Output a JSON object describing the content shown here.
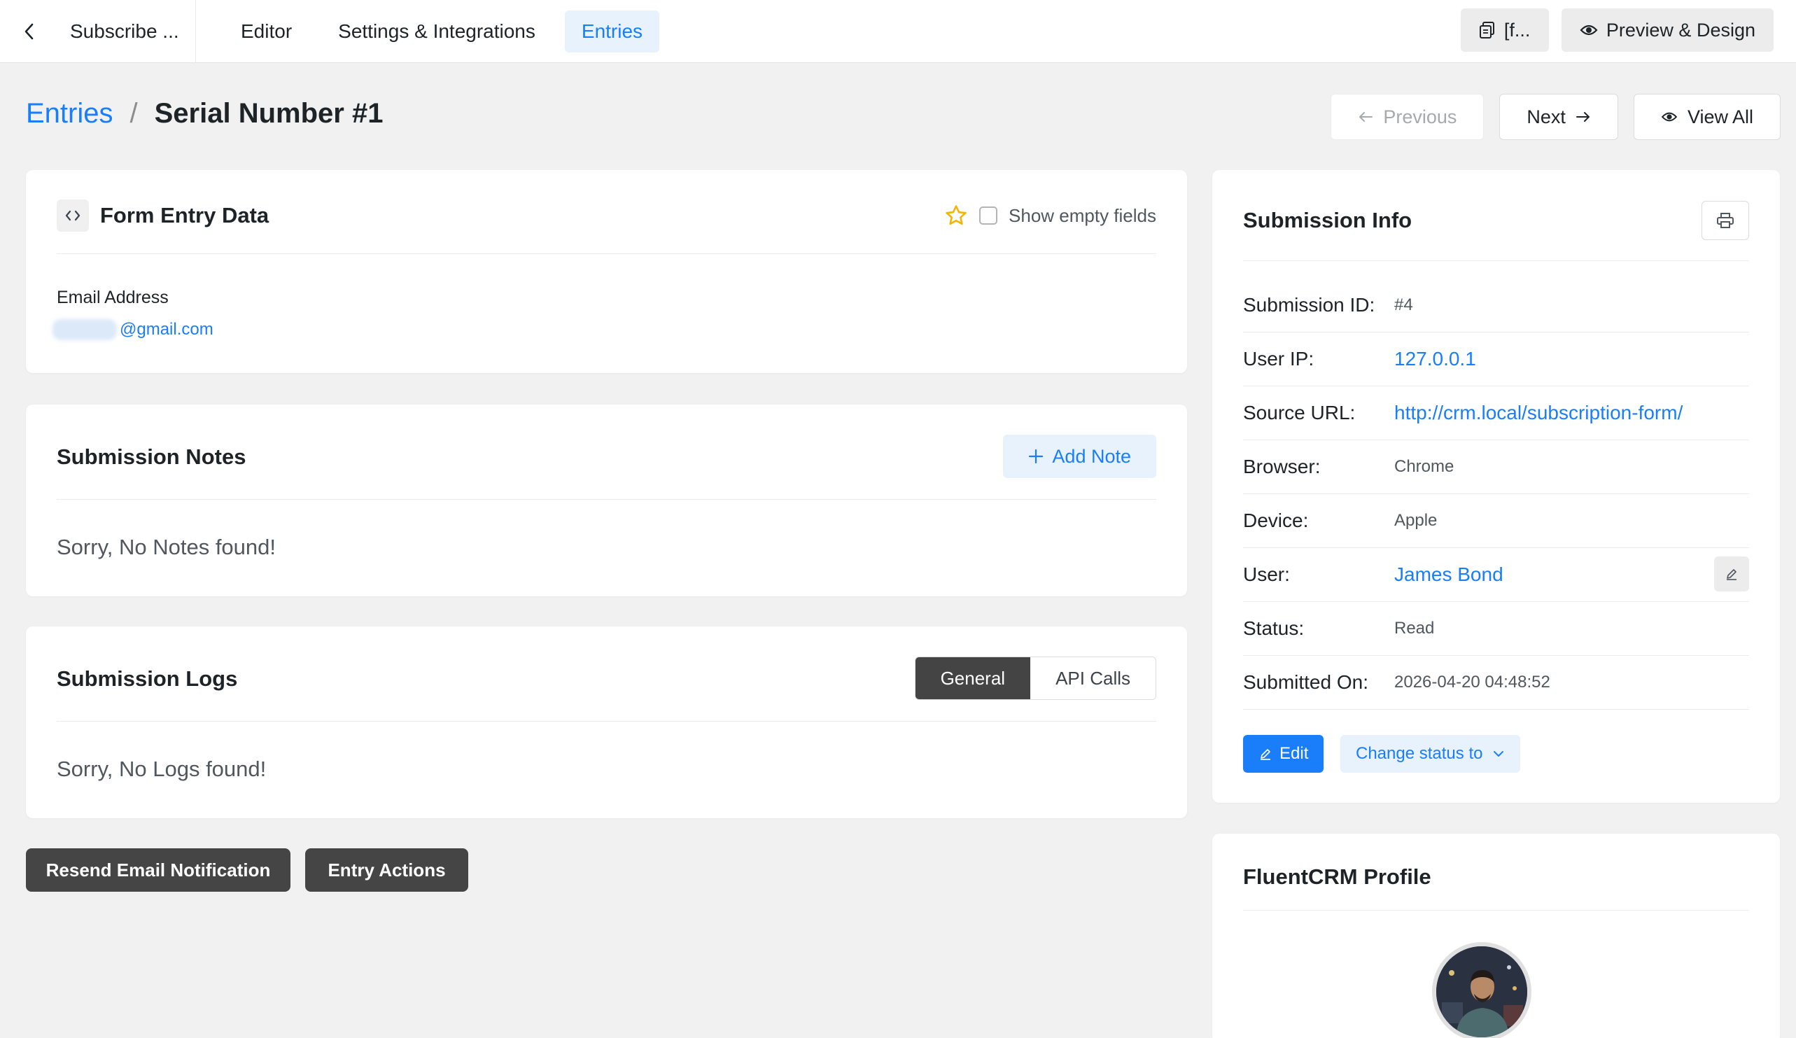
{
  "topnav": {
    "form_title": "Subscribe ...",
    "tabs": [
      "Editor",
      "Settings & Integrations",
      "Entries"
    ],
    "shortcode_label": "[f...",
    "preview_label": "Preview & Design"
  },
  "breadcrumb": {
    "parent": "Entries",
    "separator": "/",
    "current": "Serial Number #1"
  },
  "pager": {
    "previous": "Previous",
    "next": "Next",
    "view_all": "View All"
  },
  "form_entry": {
    "title": "Form Entry Data",
    "show_empty_label": "Show empty fields",
    "field_label": "Email Address",
    "field_value_suffix": "@gmail.com"
  },
  "notes": {
    "title": "Submission Notes",
    "add_label": "Add Note",
    "empty": "Sorry, No Notes found!"
  },
  "logs": {
    "title": "Submission Logs",
    "tab_general": "General",
    "tab_api": "API Calls",
    "empty": "Sorry, No Logs found!"
  },
  "actions": {
    "resend": "Resend Email Notification",
    "entry_actions": "Entry Actions"
  },
  "submission_info": {
    "title": "Submission Info",
    "rows": [
      {
        "label": "Submission ID:",
        "value": "#4"
      },
      {
        "label": "User IP:",
        "value": "127.0.0.1"
      },
      {
        "label": "Source URL:",
        "value": "http://crm.local/subscription-form/"
      },
      {
        "label": "Browser:",
        "value": "Chrome"
      },
      {
        "label": "Device:",
        "value": "Apple"
      },
      {
        "label": "User:",
        "value": "James Bond"
      },
      {
        "label": "Status:",
        "value": "Read"
      },
      {
        "label": "Submitted On:",
        "value": "2026-04-20 04:48:52"
      }
    ],
    "edit_label": "Edit",
    "change_status_label": "Change status to"
  },
  "fluentcrm": {
    "title": "FluentCRM Profile"
  },
  "colors": {
    "accent": "#1a7efb",
    "accent_light": "#e7f2fd",
    "dark_button": "#454545",
    "star": "#f5b400"
  }
}
